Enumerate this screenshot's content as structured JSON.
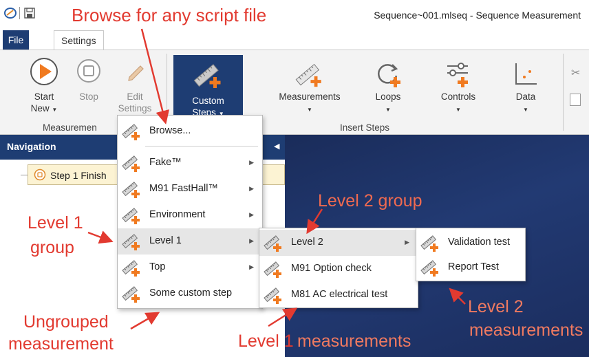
{
  "window": {
    "title": "Sequence~001.mlseq - Sequence Measurement"
  },
  "tabs": [
    {
      "label": "File"
    },
    {
      "label": "Settings"
    }
  ],
  "ribbon": {
    "measurement_group": {
      "label": "Measuremen",
      "start_label": "Start",
      "start_label2": "New",
      "stop_label": "Stop",
      "edit_label": "Edit",
      "edit_label2": "Settings"
    },
    "custom_steps_label": "Custom",
    "custom_steps_label2": "Steps",
    "insert_steps": {
      "label": "Insert Steps",
      "measurements": "Measurements",
      "loops": "Loops",
      "controls": "Controls",
      "data": "Data"
    }
  },
  "navigation": {
    "title": "Navigation",
    "step_label": "Step 1 Finish"
  },
  "menu_main": {
    "browse": "Browse...",
    "items": [
      "Fake™",
      "M91 FastHall™",
      "Environment",
      "Level 1",
      "Top",
      "Some custom step"
    ]
  },
  "menu_level1": {
    "items": [
      "Level 2",
      "M91 Option check",
      "M81 AC electrical test"
    ]
  },
  "menu_level2": {
    "items": [
      "Validation test",
      "Report Test"
    ]
  },
  "annotations": {
    "browse": "Browse for any script file",
    "level1_group_a": "Level 1",
    "level1_group_b": "group",
    "level2_group": "Level 2 group",
    "level2_meas_a": "Level 2",
    "level2_meas_b": "measurements",
    "ungrouped_a": "Ungrouped",
    "ungrouped_b": "measurement",
    "level1_meas_a": "Level 1",
    "level1_meas_b": "measurements"
  },
  "colors": {
    "accent": "#1e3d73",
    "annotation": "#e23a30",
    "play_orange": "#f07a20"
  }
}
